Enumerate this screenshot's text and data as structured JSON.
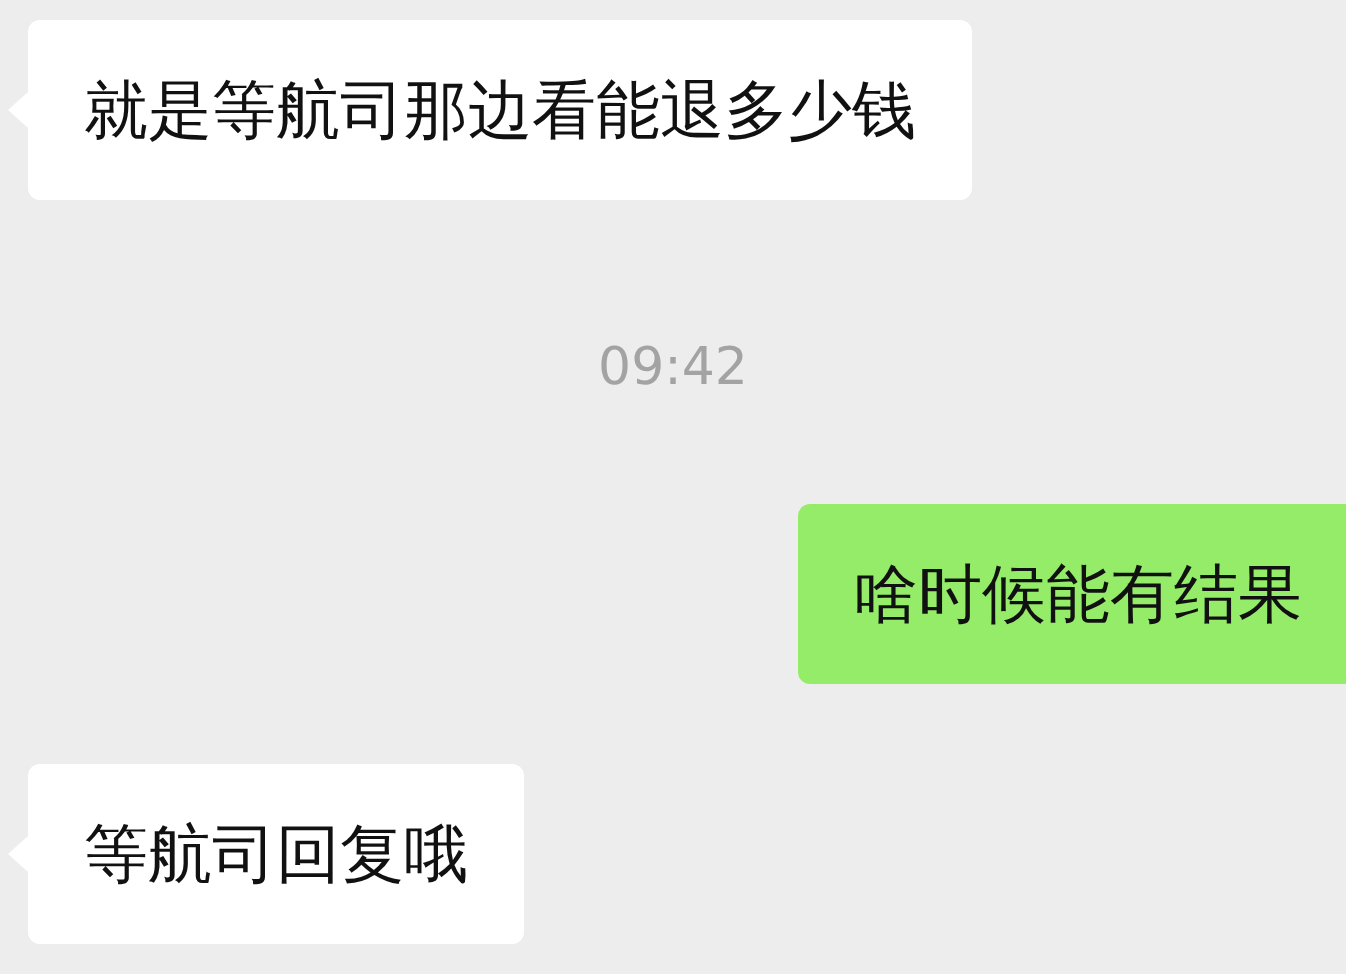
{
  "messages": [
    {
      "kind": "incoming",
      "text": "就是等航司那边看能退多少钱"
    },
    {
      "kind": "time",
      "text": "09:42"
    },
    {
      "kind": "outgoing",
      "text": "啥时候能有结果"
    },
    {
      "kind": "incoming",
      "text": "等航司回复哦"
    }
  ]
}
